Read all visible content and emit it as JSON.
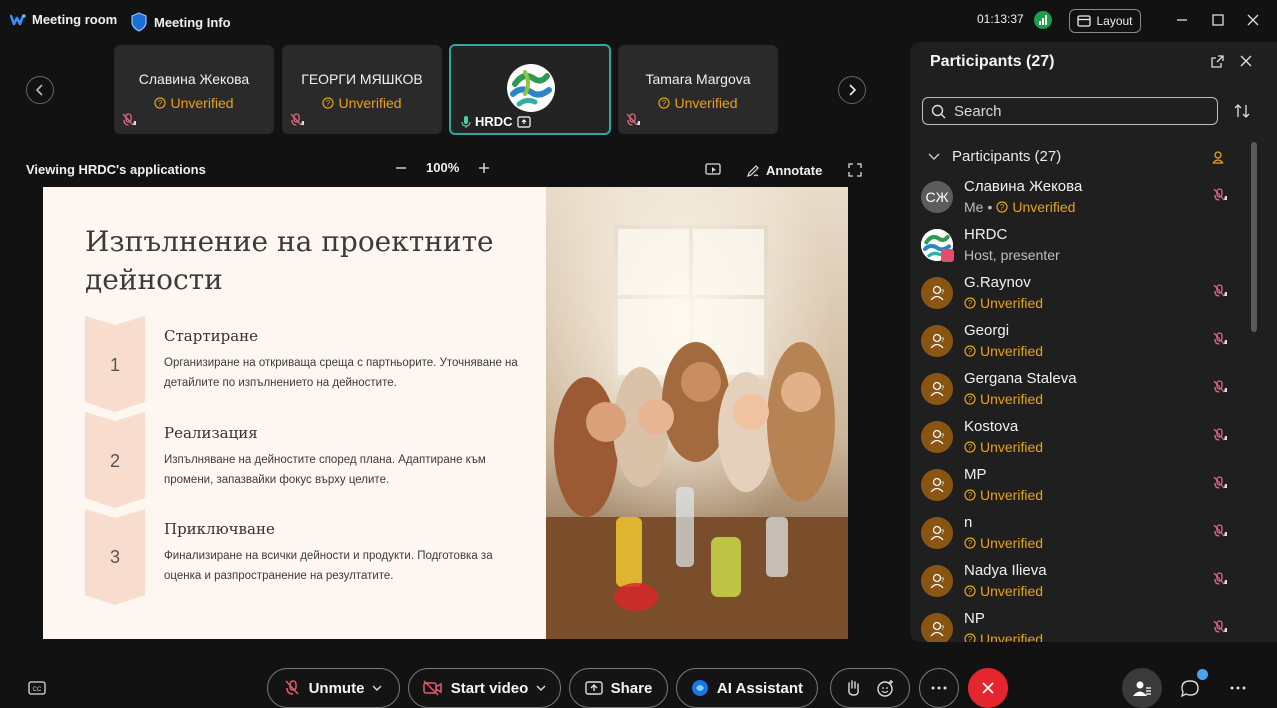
{
  "titlebar": {
    "app_label": "Meeting room",
    "info_label": "Meeting Info",
    "timer": "01:13:37",
    "layout_label": "Layout"
  },
  "thumbnails": [
    {
      "name": "Славина Жекова",
      "status": "Unverified"
    },
    {
      "name": "ГЕОРГИ МЯШКОВ",
      "status": "Unverified"
    },
    {
      "name": "HRDC",
      "status": ""
    },
    {
      "name": "Tamara Margova",
      "status": "Unverified"
    }
  ],
  "share_bar": {
    "viewing_label": "Viewing HRDC's applications",
    "zoom": "100%",
    "annotate_label": "Annotate"
  },
  "slide": {
    "title": "Изпълнение на проектните дейности",
    "steps": [
      {
        "num": "1",
        "title": "Стартиране",
        "text": "Организиране на откриваща среща с партньорите. Уточняване на детайлите по изпълнението на дейностите."
      },
      {
        "num": "2",
        "title": "Реализация",
        "text": "Изпълняване на дейностите според плана. Адаптиране към промени, запазвайки фокус върху целите."
      },
      {
        "num": "3",
        "title": "Приключване",
        "text": "Финализиране на всички дейности и продукти. Подготовка за оценка и разпространение на резултатите."
      }
    ]
  },
  "panel": {
    "title": "Participants (27)",
    "search_placeholder": "Search",
    "group_label": "Participants (27)",
    "me_label": "Me",
    "participants": [
      {
        "name": "Славина Жекова",
        "initials": "СЖ",
        "sub": "Unverified",
        "kind": "me"
      },
      {
        "name": "HRDC",
        "initials": "",
        "sub": "Host, presenter",
        "kind": "host"
      },
      {
        "name": "G.Raynov",
        "initials": "",
        "sub": "Unverified",
        "kind": "guest"
      },
      {
        "name": "Georgi",
        "initials": "",
        "sub": "Unverified",
        "kind": "guest"
      },
      {
        "name": "Gergana Staleva",
        "initials": "",
        "sub": "Unverified",
        "kind": "guest"
      },
      {
        "name": "Kostova",
        "initials": "",
        "sub": "Unverified",
        "kind": "guest"
      },
      {
        "name": "MP",
        "initials": "",
        "sub": "Unverified",
        "kind": "guest"
      },
      {
        "name": "n",
        "initials": "",
        "sub": "Unverified",
        "kind": "guest"
      },
      {
        "name": "Nadya Ilieva",
        "initials": "",
        "sub": "Unverified",
        "kind": "guest"
      },
      {
        "name": "NP",
        "initials": "",
        "sub": "Unverified",
        "kind": "guest"
      }
    ]
  },
  "bottom": {
    "unmute_label": "Unmute",
    "start_video_label": "Start video",
    "share_label": "Share",
    "ai_label": "AI Assistant"
  },
  "colors": {
    "accent_teal": "#2fa8a0",
    "warning_orange": "#e6a21c",
    "end_red": "#e5262f",
    "avatar_brown": "#8a5512"
  }
}
